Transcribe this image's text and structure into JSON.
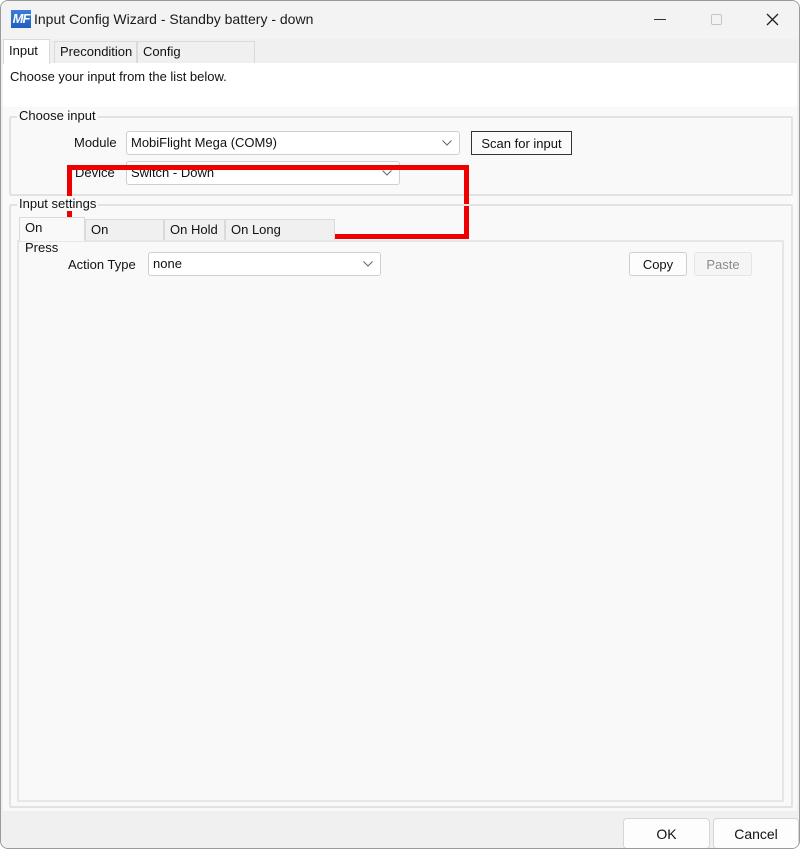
{
  "window": {
    "title": "Input Config Wizard - Standby battery - down",
    "logo_text": "MF",
    "controls": {
      "minimize": "minimize-icon",
      "maximize": "maximize-icon",
      "close": "close-icon"
    }
  },
  "tabs": [
    {
      "label": "Input",
      "active": true
    },
    {
      "label": "Precondition",
      "active": false
    },
    {
      "label": "Config References",
      "active": false
    }
  ],
  "input_page": {
    "intro_text": "Choose your input from the list below.",
    "choose_input": {
      "group_label": "Choose input",
      "module_label": "Module",
      "module_value": "MobiFlight Mega (COM9)",
      "device_label": "Device",
      "device_value": "Switch - Down",
      "scan_button": "Scan for input",
      "highlight_color": "#ee0000"
    },
    "input_settings": {
      "group_label": "Input settings",
      "tabs": [
        {
          "label": "On Press",
          "active": true
        },
        {
          "label": "On Release",
          "active": false
        },
        {
          "label": "On Hold",
          "active": false
        },
        {
          "label": "On Long Release",
          "active": false
        }
      ],
      "action_type_label": "Action Type",
      "action_type_value": "none",
      "copy_button": "Copy",
      "paste_button": "Paste",
      "paste_disabled": true
    }
  },
  "footer": {
    "ok_button": "OK",
    "cancel_button": "Cancel"
  }
}
